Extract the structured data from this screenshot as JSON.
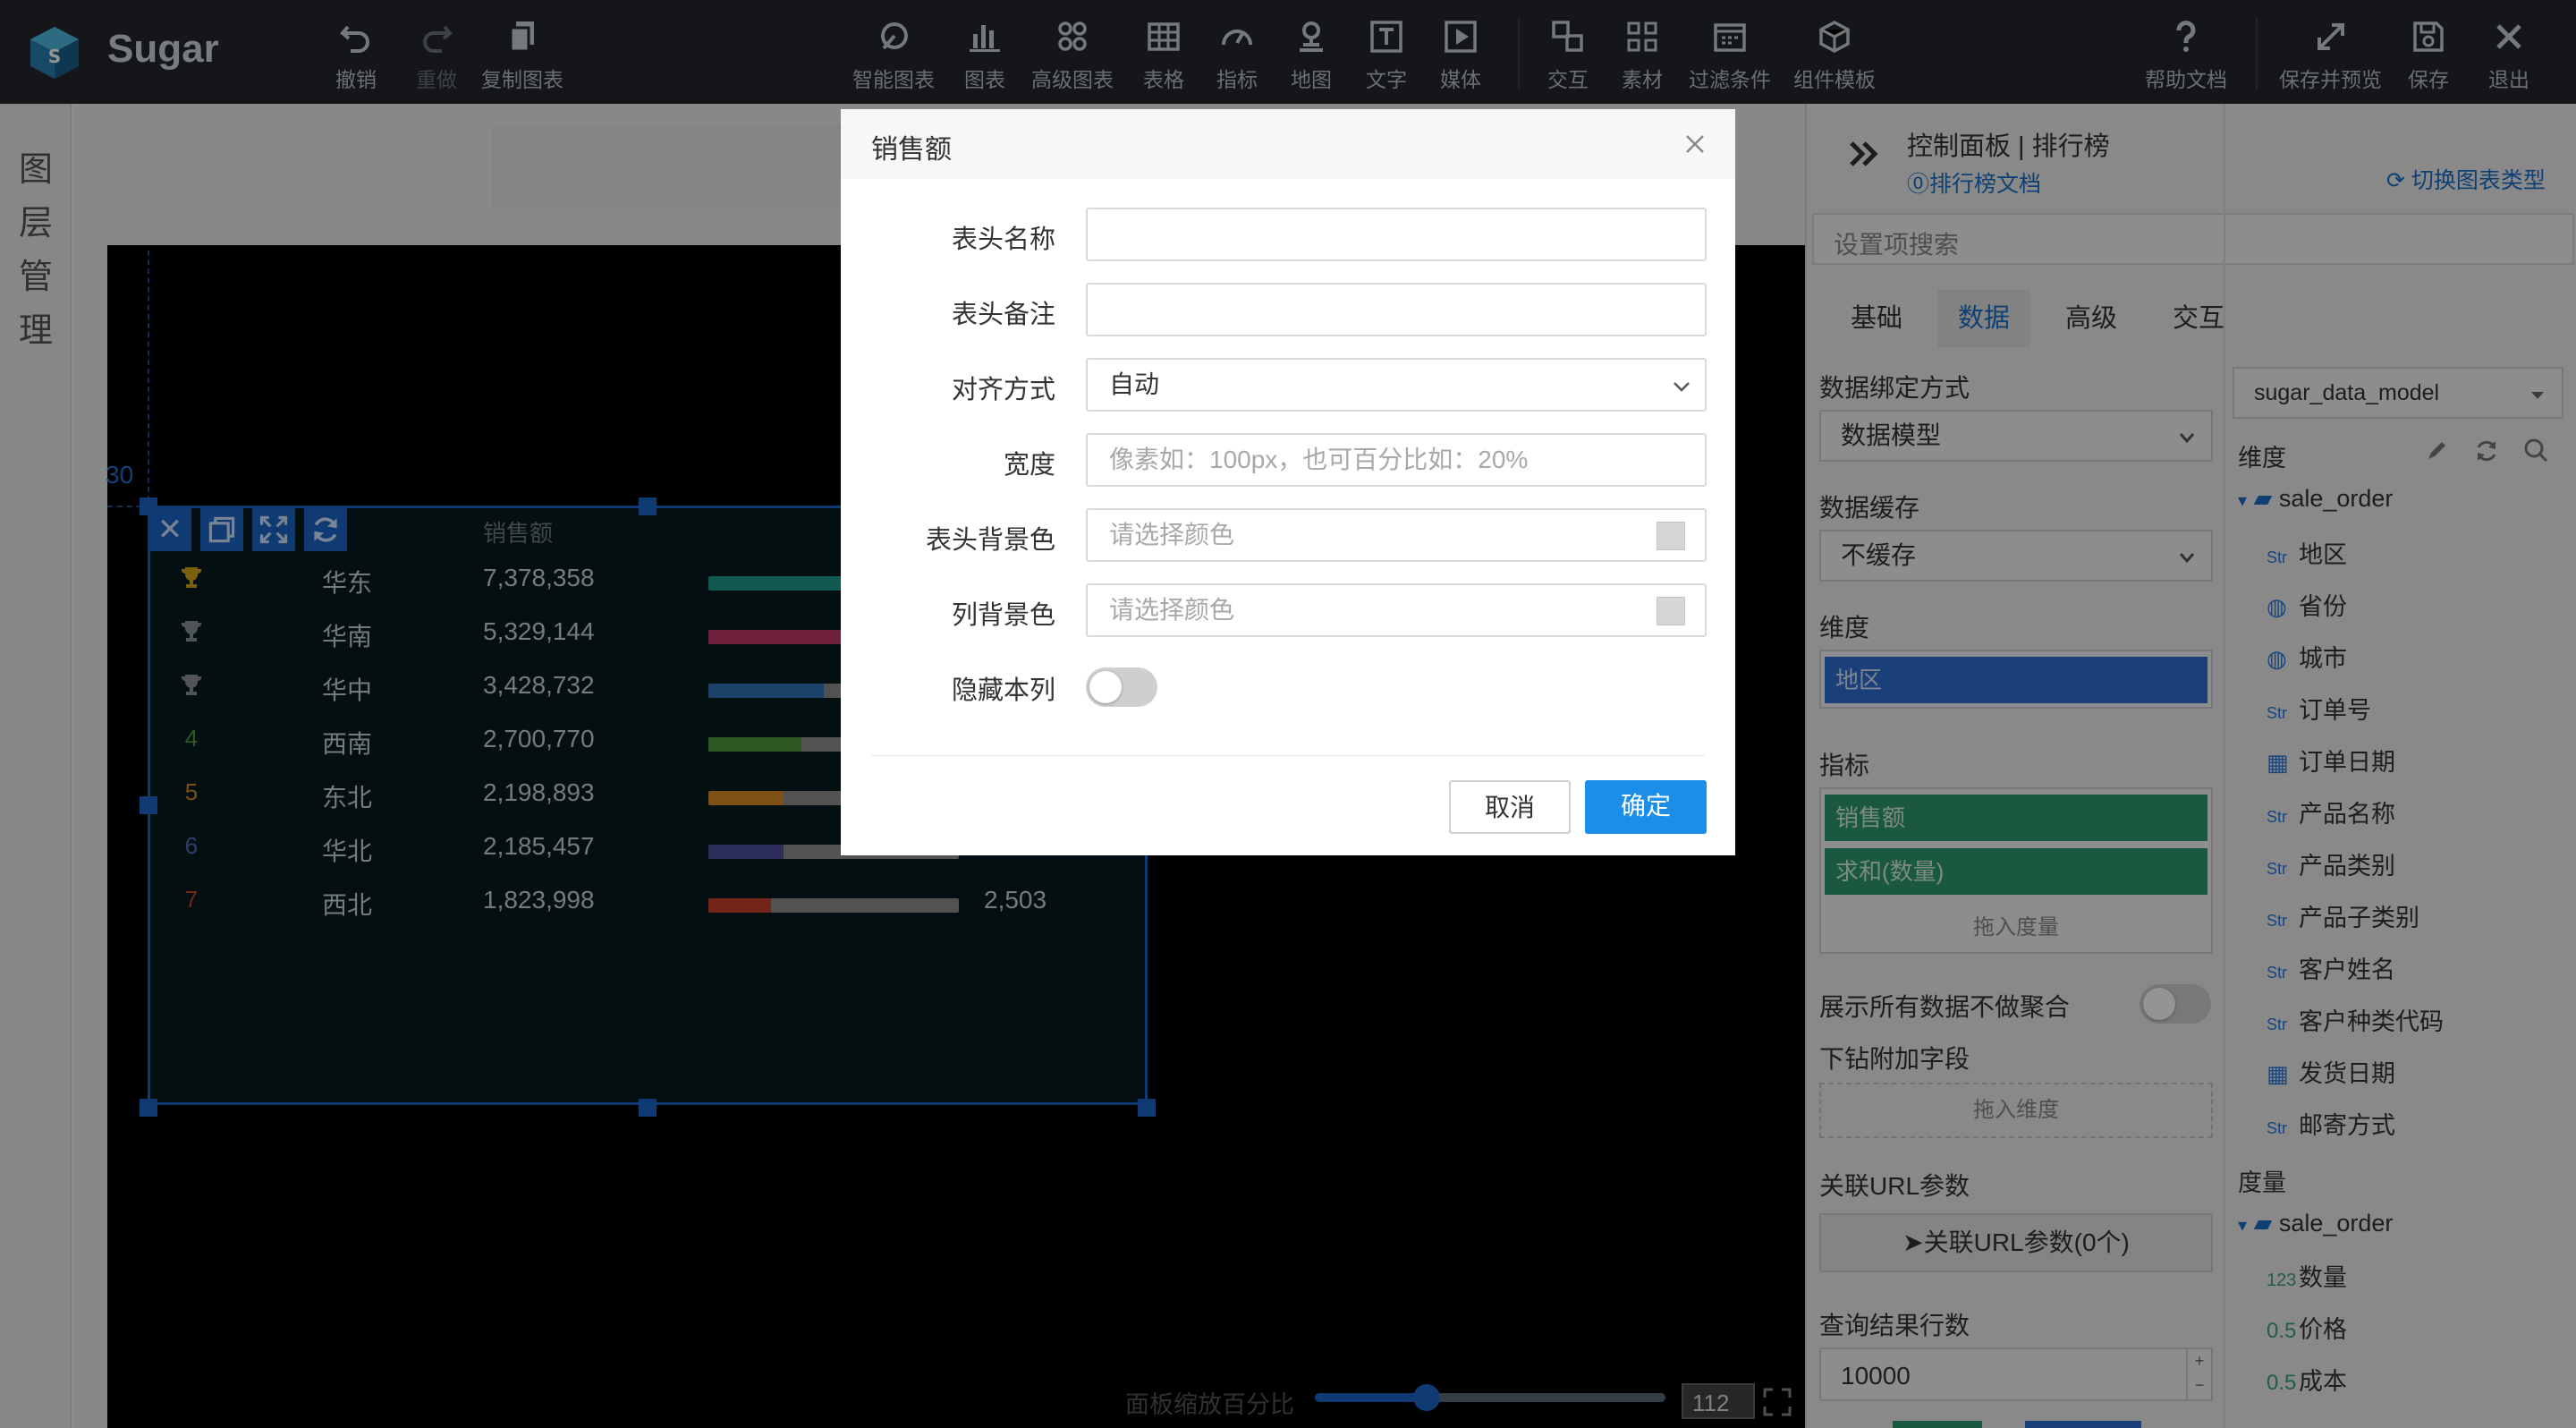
{
  "app": {
    "name": "Sugar"
  },
  "toolbar": {
    "undo": "撤销",
    "redo": "重做",
    "copy_chart": "复制图表",
    "smart_chart": "智能图表",
    "chart": "图表",
    "advanced_chart": "高级图表",
    "table": "表格",
    "metric": "指标",
    "map": "地图",
    "text": "文字",
    "media": "媒体",
    "interaction": "交互",
    "assets": "素材",
    "filter": "过滤条件",
    "component_template": "组件模板",
    "help_doc": "帮助文档",
    "save_preview": "保存并预览",
    "save": "保存",
    "exit": "退出"
  },
  "layer_panel": {
    "label": "图层管理"
  },
  "canvas": {
    "ruler_value": "30",
    "ranking": {
      "header_sales": "销售额",
      "rows": [
        {
          "rank": "1",
          "region": "华东",
          "sales": "7,378,358",
          "bar_fraction": 1.0,
          "bar_color": "#1d9c8e",
          "qty": ""
        },
        {
          "rank": "2",
          "region": "华南",
          "sales": "5,329,144",
          "bar_fraction": 0.72,
          "bar_color": "#c23a6b",
          "qty": ""
        },
        {
          "rank": "3",
          "region": "华中",
          "sales": "3,428,732",
          "bar_fraction": 0.46,
          "bar_color": "#2f73b5",
          "qty": ""
        },
        {
          "rank": "4",
          "region": "西南",
          "sales": "2,700,770",
          "bar_fraction": 0.37,
          "bar_color": "#4d9a3a",
          "qty": ""
        },
        {
          "rank": "5",
          "region": "东北",
          "sales": "2,198,893",
          "bar_fraction": 0.3,
          "bar_color": "#d88a24",
          "qty": ""
        },
        {
          "rank": "6",
          "region": "华北",
          "sales": "2,185,457",
          "bar_fraction": 0.3,
          "bar_color": "#4d4f9e",
          "qty": ""
        },
        {
          "rank": "7",
          "region": "西北",
          "sales": "1,823,998",
          "bar_fraction": 0.25,
          "bar_color": "#c8402c",
          "qty": "2,503"
        }
      ],
      "rank_colors": {
        "4": "#4d9a3a",
        "5": "#d88a24",
        "6": "#4d6fb5",
        "7": "#c8402c"
      }
    },
    "zoom_label": "面板缩放百分比",
    "zoom_value": "112",
    "zoom_fraction": 0.32
  },
  "right_panel": {
    "breadcrumb": "控制面板 | 排行榜",
    "doc_link": "⓪排行榜文档",
    "switch_type": "切换图表类型",
    "search_placeholder": "设置项搜索",
    "tabs": [
      "基础",
      "数据",
      "高级",
      "交互"
    ],
    "active_tab": "数据",
    "binding_label": "数据绑定方式",
    "binding_value": "数据模型",
    "cache_label": "数据缓存",
    "cache_value": "不缓存",
    "dimension_label": "维度",
    "dimension_value": "地区",
    "measure_label": "指标",
    "measure_values": [
      "销售额",
      "求和(数量)"
    ],
    "drop_measure": "拖入度量",
    "no_aggregate_label": "展示所有数据不做聚合",
    "drill_label": "下钻附加字段",
    "drop_dimension": "拖入维度",
    "url_params_label": "关联URL参数",
    "url_params_button": "关联URL参数(0个)",
    "rows_label": "查询结果行数",
    "rows_value": "10000",
    "model_select": "sugar_data_model",
    "dims_heading": "维度",
    "dim_table": "sale_order",
    "dim_fields": [
      {
        "type": "Str",
        "name": "地区"
      },
      {
        "type": "geo",
        "name": "省份"
      },
      {
        "type": "geo",
        "name": "城市"
      },
      {
        "type": "Str",
        "name": "订单号"
      },
      {
        "type": "date",
        "name": "订单日期"
      },
      {
        "type": "Str",
        "name": "产品名称"
      },
      {
        "type": "Str",
        "name": "产品类别"
      },
      {
        "type": "Str",
        "name": "产品子类别"
      },
      {
        "type": "Str",
        "name": "客户姓名"
      },
      {
        "type": "Str",
        "name": "客户种类代码"
      },
      {
        "type": "date",
        "name": "发货日期"
      },
      {
        "type": "Str",
        "name": "邮寄方式"
      }
    ],
    "measures_heading": "度量",
    "measure_table": "sale_order",
    "measure_fields": [
      {
        "type": "123",
        "name": "数量"
      },
      {
        "type": "0.5",
        "name": "价格"
      },
      {
        "type": "0.5",
        "name": "成本"
      }
    ]
  },
  "dialog": {
    "title": "销售额",
    "header_name_label": "表头名称",
    "header_name_value": "",
    "header_note_label": "表头备注",
    "header_note_value": "",
    "align_label": "对齐方式",
    "align_value": "自动",
    "width_label": "宽度",
    "width_placeholder": "像素如：100px，也可百分比如：20%",
    "header_bg_label": "表头背景色",
    "header_bg_placeholder": "请选择颜色",
    "col_bg_label": "列背景色",
    "col_bg_placeholder": "请选择颜色",
    "hide_col_label": "隐藏本列",
    "cancel": "取消",
    "ok": "确定"
  },
  "colors": {
    "toolbar_bg": "#23272b",
    "accent": "#1c65c6",
    "primary_button": "#1a8ee9",
    "pill_dimension": "#2f6fd0",
    "pill_measure": "#2d9a6e"
  }
}
